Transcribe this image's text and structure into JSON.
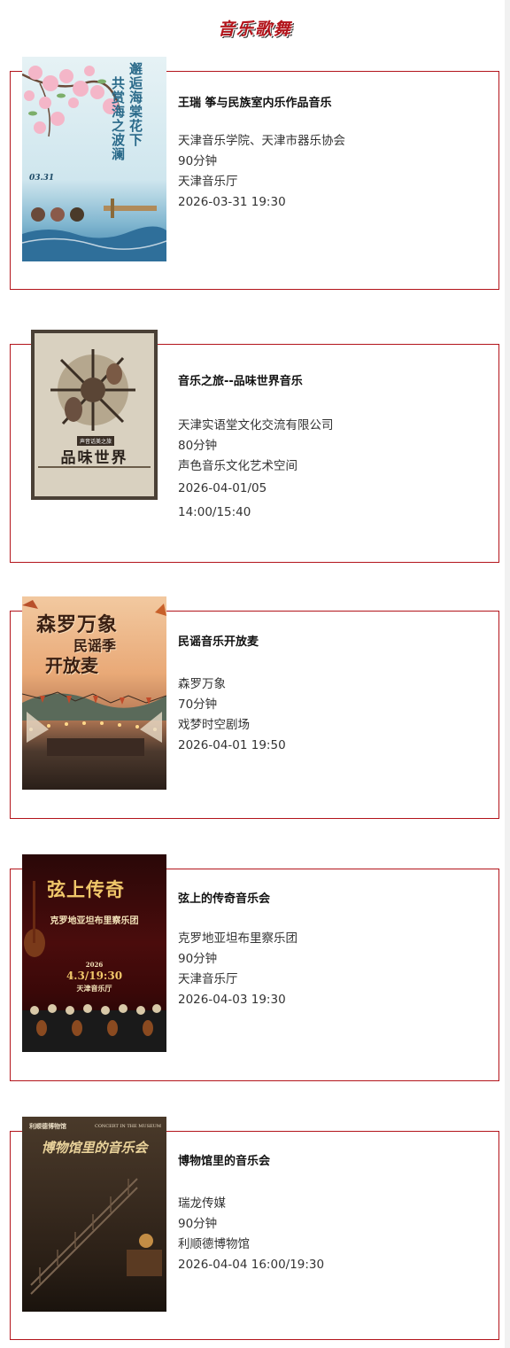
{
  "section": {
    "title": "音乐歌舞"
  },
  "colors": {
    "accent": "#b3141b"
  },
  "events": [
    {
      "title": "王瑞 筝与民族室内乐作品音乐",
      "organizer": "天津音乐学院、天津市器乐协会",
      "duration": "90分钟",
      "venue": "天津音乐厅",
      "time": "2026-03-31 19:30",
      "poster": {
        "headline_1": "邂逅海棠花下",
        "headline_2": "共赏海之波澜",
        "date": "03.31"
      }
    },
    {
      "title": "音乐之旅--品味世界音乐",
      "organizer": "天津实语堂文化交流有限公司",
      "duration": "80分钟",
      "venue": "声色音乐文化艺术空间",
      "date": "2026-04-01/05",
      "time": "14:00/15:40",
      "poster": {
        "headline": "品味世界",
        "tag": "声音话美之旅"
      }
    },
    {
      "title": "民谣音乐开放麦",
      "organizer": "森罗万象",
      "duration": "70分钟",
      "venue": "戏梦时空剧场",
      "time": "2026-04-01 19:50",
      "poster": {
        "headline_1": "森罗万象",
        "headline_2": "民谣季",
        "headline_3": "开放麦"
      }
    },
    {
      "title": "弦上的传奇音乐会",
      "organizer": "克罗地亚坦布里察乐团",
      "duration": "90分钟",
      "venue": "天津音乐厅",
      "time": "2026-04-03 19:30",
      "poster": {
        "headline": "弦上传奇",
        "subtitle": "克罗地亚坦布里察乐团",
        "year": "2026",
        "date": "4.3/19:30",
        "venue": "天津音乐厅"
      }
    },
    {
      "title": "博物馆里的音乐会",
      "organizer": "瑞龙传媒",
      "duration": "90分钟",
      "venue": "利顺德博物馆",
      "time": "2026-04-04 16:00/19:30",
      "poster": {
        "headline": "博物馆里的音乐会",
        "brand": "利顺德博物馆",
        "en": "CONCERT IN THE MUSEUM"
      }
    }
  ]
}
